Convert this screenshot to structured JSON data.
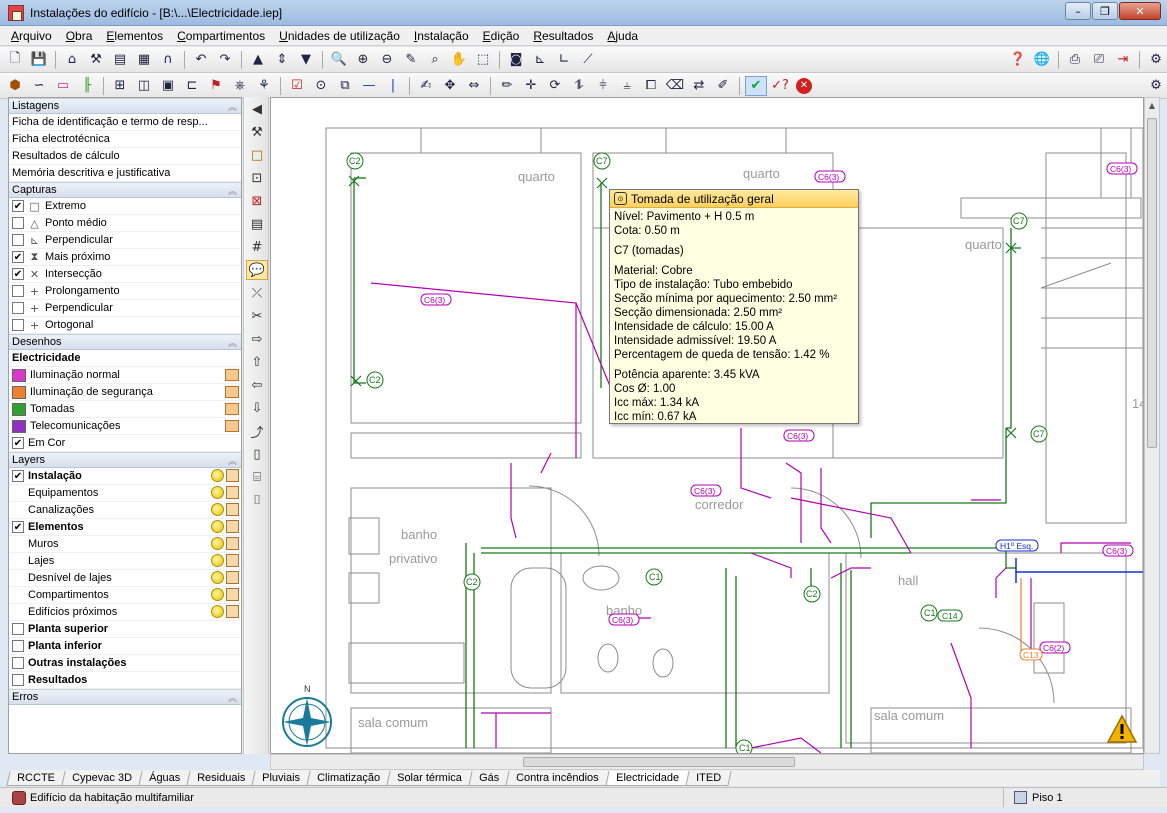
{
  "window": {
    "title": "Instalações do edifício - [B:\\...\\Electricidade.iep]"
  },
  "menu": [
    "Arquivo",
    "Obra",
    "Elementos",
    "Compartimentos",
    "Unidades de utilização",
    "Instalação",
    "Edição",
    "Resultados",
    "Ajuda"
  ],
  "left_panel": {
    "listagens": {
      "header": "Listagens",
      "items": [
        "Ficha de identificação e termo de resp...",
        "Ficha electrotécnica",
        "Resultados de cálculo",
        "Memória descritiva e justificativa"
      ]
    },
    "capturas": {
      "header": "Capturas",
      "items": [
        {
          "label": "Extremo",
          "checked": true,
          "icon": "square-snap-icon"
        },
        {
          "label": "Ponto médio",
          "checked": false,
          "icon": "triangle-snap-icon"
        },
        {
          "label": "Perpendicular",
          "checked": false,
          "icon": "perpendicular-snap-icon"
        },
        {
          "label": "Mais próximo",
          "checked": true,
          "icon": "hourglass-snap-icon"
        },
        {
          "label": "Intersecção",
          "checked": true,
          "icon": "cross-snap-icon"
        },
        {
          "label": "Prolongamento",
          "checked": false,
          "icon": "plus-snap-icon"
        },
        {
          "label": "Perpendicular",
          "checked": false,
          "icon": "plus-snap-icon"
        },
        {
          "label": "Ortogonal",
          "checked": false,
          "icon": "plus-snap-icon"
        }
      ]
    },
    "desenhos": {
      "header": "Desenhos",
      "group": "Electricidade",
      "items": [
        {
          "label": "Iluminação normal",
          "color": "#d838c8"
        },
        {
          "label": "Iluminação de segurança",
          "color": "#f08030"
        },
        {
          "label": "Tomadas",
          "color": "#30a030"
        },
        {
          "label": "Telecomunicações",
          "color": "#9030c0"
        }
      ],
      "em_cor": {
        "label": "Em Cor",
        "checked": true
      }
    },
    "layers": {
      "header": "Layers",
      "items": [
        {
          "label": "Instalação",
          "checked": true,
          "bold": true,
          "indent": false,
          "icons": true
        },
        {
          "label": "Equipamentos",
          "checked": null,
          "bold": false,
          "indent": true,
          "icons": true
        },
        {
          "label": "Canalizações",
          "checked": null,
          "bold": false,
          "indent": true,
          "icons": true
        },
        {
          "label": "Elementos",
          "checked": true,
          "bold": true,
          "indent": false,
          "icons": true
        },
        {
          "label": "Muros",
          "checked": null,
          "bold": false,
          "indent": true,
          "icons": true
        },
        {
          "label": "Lajes",
          "checked": null,
          "bold": false,
          "indent": true,
          "icons": true
        },
        {
          "label": "Desnível de lajes",
          "checked": null,
          "bold": false,
          "indent": true,
          "icons": true
        },
        {
          "label": "Compartimentos",
          "checked": null,
          "bold": false,
          "indent": true,
          "icons": true
        },
        {
          "label": "Edifícios próximos",
          "checked": null,
          "bold": false,
          "indent": true,
          "icons": true
        },
        {
          "label": "Planta superior",
          "checked": false,
          "bold": true,
          "indent": false,
          "icons": false
        },
        {
          "label": "Planta inferior",
          "checked": false,
          "bold": true,
          "indent": false,
          "icons": false
        },
        {
          "label": "Outras instalações",
          "checked": false,
          "bold": true,
          "indent": false,
          "icons": false
        },
        {
          "label": "Resultados",
          "checked": false,
          "bold": true,
          "indent": false,
          "icons": false
        }
      ]
    },
    "erros": {
      "header": "Erros"
    }
  },
  "tooltip": {
    "title": "Tomada de utilização geral",
    "lines_a": [
      "Nível: Pavimento + H 0.5 m",
      "Cota: 0.50 m"
    ],
    "circuit": "C7 (tomadas)",
    "lines_b": [
      "Material: Cobre",
      "Tipo de instalação: Tubo embebido",
      "Secção mínima por aquecimento: 2.50 mm²",
      "Secção dimensionada: 2.50 mm²",
      "Intensidade de cálculo: 15.00 A",
      "Intensidade admissível: 19.50 A",
      "Percentagem de queda de tensão: 1.42 %"
    ],
    "lines_c": [
      "Potência aparente: 3.45 kVA",
      "Cos Ø: 1.00",
      "Icc máx: 1.34 kA",
      "Icc mín: 0.67 kA"
    ]
  },
  "drawing": {
    "room_labels": [
      "quarto",
      "quarto",
      "quarto",
      "banho",
      "privativo",
      "corredor",
      "banho",
      "hall",
      "sala comum",
      "sala comum"
    ],
    "circuit_tags": [
      "C2",
      "C7",
      "C2",
      "C7",
      "C7",
      "C2",
      "C1",
      "C2",
      "C1",
      "C1"
    ],
    "cable_tags": [
      "C6(3)",
      "C6(3)",
      "C6(3)",
      "C6(3)",
      "C6(3)",
      "C6(3)",
      "C6(3)",
      "C6(2)",
      "C14",
      "C13"
    ],
    "board_label": "H1º Esq.",
    "compass_label": "N",
    "partial_number": "14"
  },
  "tabs": [
    {
      "label": "RCCTE",
      "active": false
    },
    {
      "label": "Cypevac 3D",
      "active": false
    },
    {
      "label": "Águas",
      "active": false
    },
    {
      "label": "Residuais",
      "active": false
    },
    {
      "label": "Pluviais",
      "active": false
    },
    {
      "label": "Climatização",
      "active": false
    },
    {
      "label": "Solar térmica",
      "active": false
    },
    {
      "label": "Gás",
      "active": false
    },
    {
      "label": "Contra incêndios",
      "active": false
    },
    {
      "label": "Electricidade",
      "active": true
    },
    {
      "label": "ITED",
      "active": false
    }
  ],
  "status": {
    "project": "Edifício da habitação multifamiliar",
    "floor": "Piso 1"
  },
  "colors": {
    "installation": "#b400b4",
    "earth": "#1a7a1a",
    "walls": "#808080"
  }
}
